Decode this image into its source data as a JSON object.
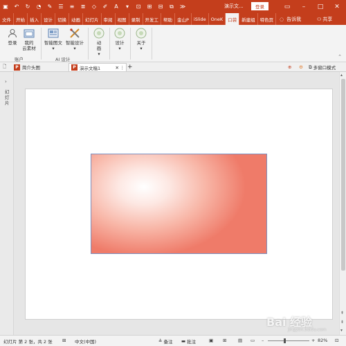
{
  "titlebar": {
    "title": "演示文...",
    "login": "登录",
    "quick_access": [
      "save-icon",
      "undo-icon",
      "redo-icon",
      "spell-icon",
      "format-painter-icon",
      "bullets-icon",
      "numbering-icon",
      "align-icon",
      "shape-icon",
      "font-color-icon",
      "text-icon",
      "crop-icon",
      "group-icon",
      "more-icon"
    ]
  },
  "tabs": [
    "文件",
    "开始",
    "插入",
    "设计",
    "切换",
    "动画",
    "幻灯片",
    "审阅",
    "视图",
    "录制",
    "开发工",
    "帮助",
    "金山P",
    "iSlide",
    "OneK",
    "口袋",
    "新建组",
    "特色页"
  ],
  "active_tab": "口袋",
  "tell_me": "告诉我",
  "share": "共享",
  "ribbon": {
    "login": "登录",
    "my_cloud": "我的\n云素材",
    "account_group": "账户",
    "smart_graphics": "智能图文",
    "smart_design": "智能设计",
    "ai_group": "AI 设计",
    "animation": "动\n画",
    "design": "设计",
    "about": "关于"
  },
  "doc_tabs": {
    "tab1": "简介头图",
    "tab2": "演示文稿1",
    "add": "+",
    "multi_window": "多窗口模式"
  },
  "left_panel": {
    "label": "幻灯片"
  },
  "status": {
    "slide_info": "幻灯片 第 2 张，共 2 张",
    "language": "中文(中国)",
    "notes": "备注",
    "comments": "批注",
    "zoom": "82%"
  },
  "watermark": "Bai 经验",
  "watermark_sub": "jingyan.baidu.com",
  "colors": {
    "accent": "#c43e1c",
    "shape_edge": "#ef7b69"
  }
}
